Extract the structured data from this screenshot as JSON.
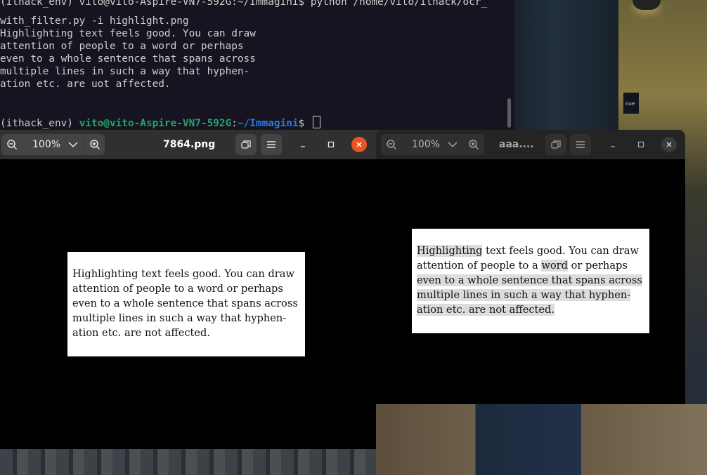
{
  "terminal": {
    "line0": "(ithack_env) vito@vito-Aspire-VN7-592G:~/Immagini$ python /home/vito/ithack/ocr_",
    "line1": "with_filter.py -i highlight.png",
    "output": [
      "Highlighting text feels good. You can draw",
      "attention of people to a word or perhaps",
      "even to a whole sentence that spans across",
      "multiple lines in such a way that hyphen-",
      "ation etc. are uot affected."
    ],
    "prompt_env": "(ithack_env) ",
    "prompt_user": "vito@vito-Aspire-VN7-592G",
    "prompt_sep": ":",
    "prompt_path": "~/Immagini",
    "prompt_end": "$ "
  },
  "viewer_left": {
    "zoom": "100%",
    "title": "7864.png",
    "text_lines": [
      "Highlighting text feels good.  You can draw",
      "attention of people to a word or perhaps",
      "even to a whole sentence that spans across",
      "multiple lines in such a way that hyphen-",
      "ation etc. are not affected."
    ]
  },
  "viewer_right": {
    "zoom": "100%",
    "title": "aaa....",
    "text": {
      "l1_hl": "Highlighting",
      "l1_rest": " text feels good.  You can draw",
      "l2_a": "attention of people to a ",
      "l2_hl": "word",
      "l2_b": " or perhaps",
      "l3": "even to a whole sentence that spans across",
      "l4": "multiple lines in such a way that hyphen-",
      "l5": "ation etc. are not affected."
    }
  },
  "colors": {
    "terminal_bg": "#171421",
    "prompt_user": "#26a269",
    "prompt_path": "#2a7bde",
    "close_active": "#e95420",
    "highlight": "#dcdcdc"
  }
}
